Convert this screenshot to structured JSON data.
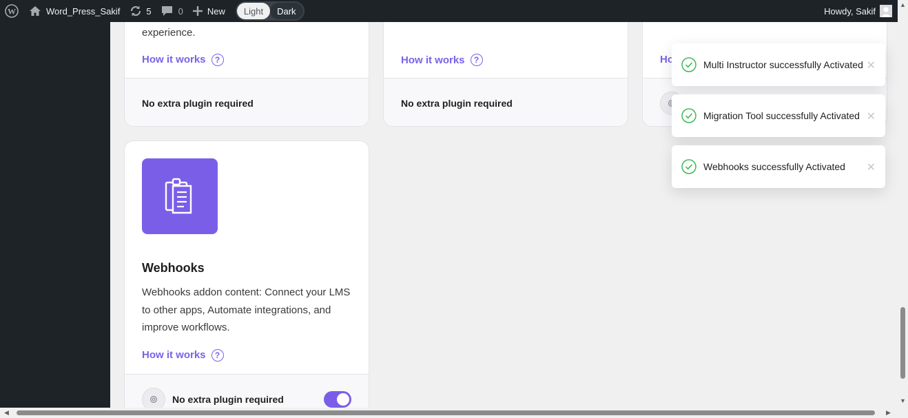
{
  "adminbar": {
    "site_name": "Word_Press_Sakif",
    "updates_count": "5",
    "comments_count": "0",
    "new_label": "New",
    "theme_light": "Light",
    "theme_dark": "Dark",
    "howdy": "Howdy, Sakif"
  },
  "cards": {
    "card1": {
      "desc_tail": "experience.",
      "how_label": "How it works",
      "footer_text": "No extra plugin required"
    },
    "card2": {
      "how_label": "How it works",
      "footer_text": "No extra plugin required"
    },
    "card3": {
      "how_label_partial": "Ho"
    },
    "webhooks": {
      "title": "Webhooks",
      "description": "Webhooks addon content: Connect your LMS to other apps, Automate integrations, and improve workflows.",
      "how_label": "How it works",
      "footer_text": "No extra plugin required",
      "enabled": true
    }
  },
  "toasts": [
    {
      "message": "Multi Instructor successfully Activated"
    },
    {
      "message": "Migration Tool successfully Activated"
    },
    {
      "message": "Webhooks successfully Activated"
    }
  ],
  "colors": {
    "accent": "#7b5ee8",
    "adminbar": "#1d2327",
    "success": "#3db856"
  },
  "icons": [
    "wordpress-logo-icon",
    "home-icon",
    "updates-icon",
    "comment-icon",
    "plus-icon",
    "avatar-icon",
    "help-icon",
    "clipboard-icon",
    "gear-icon",
    "check-circle-icon",
    "close-icon"
  ]
}
